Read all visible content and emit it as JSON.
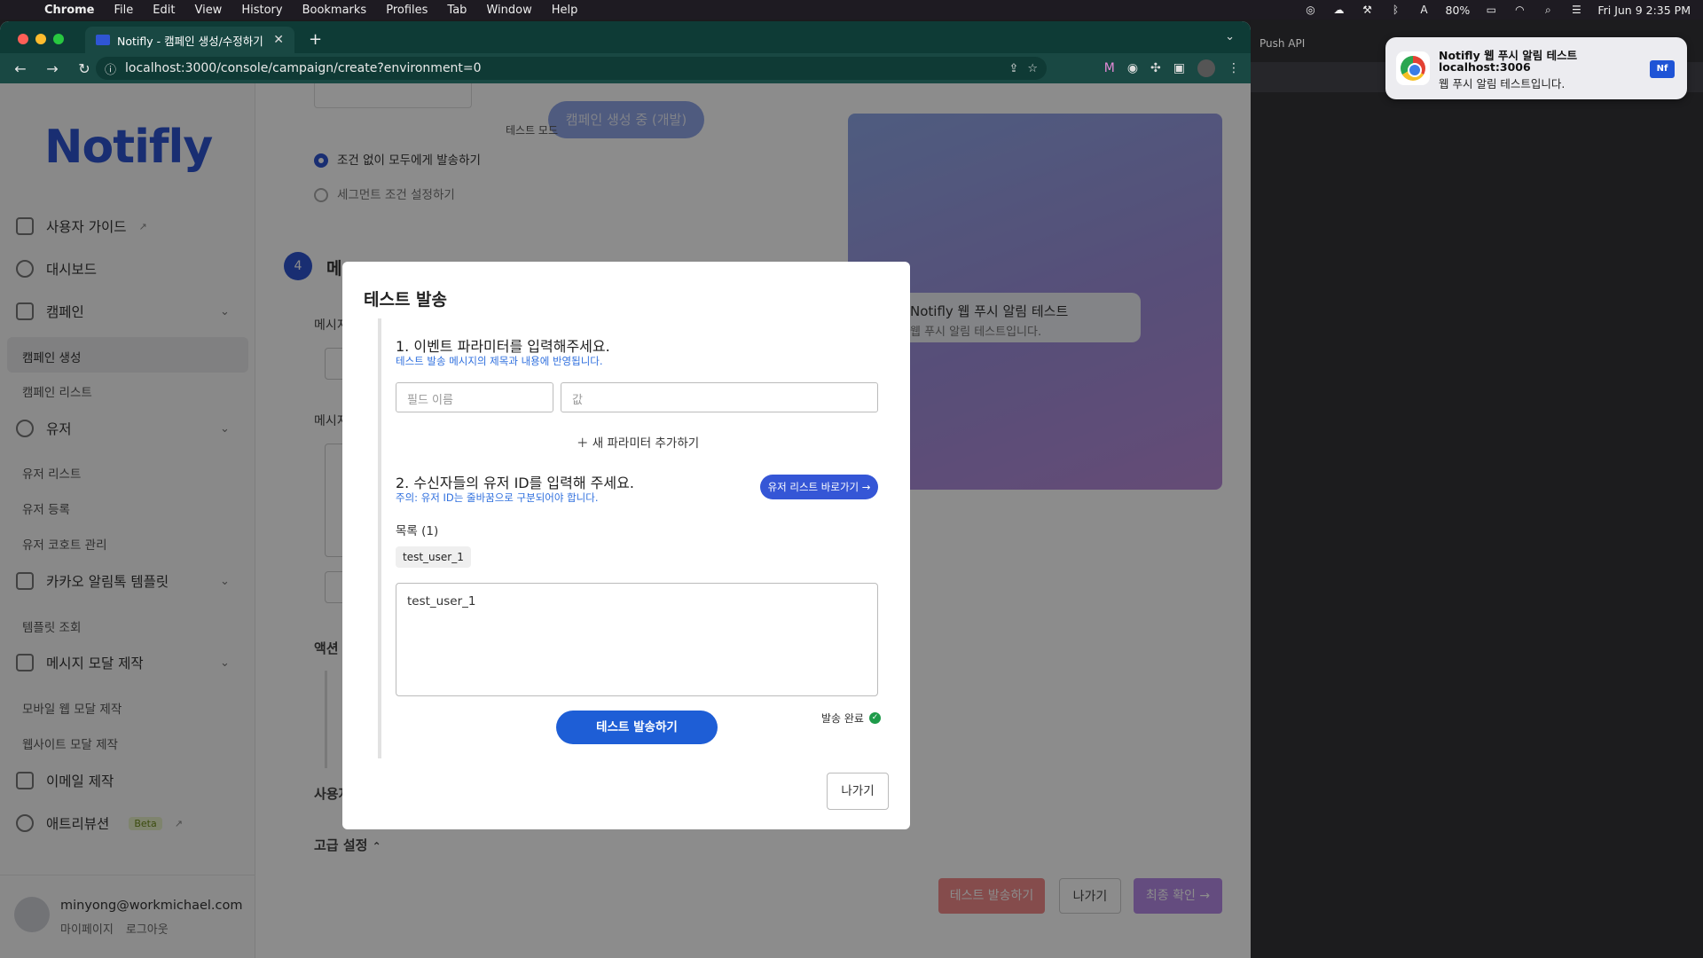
{
  "menubar": {
    "app": "Chrome",
    "menus": [
      "File",
      "Edit",
      "View",
      "History",
      "Bookmarks",
      "Profiles",
      "Tab",
      "Window",
      "Help"
    ],
    "battery": "80%",
    "datetime": "Fri Jun 9  2:35 PM"
  },
  "browser": {
    "tab_title": "Notifly - 캠페인 생성/수정하기",
    "url": "localhost:3000/console/campaign/create?environment=0",
    "bg_tab": "Push API"
  },
  "sidebar": {
    "logo": "Notifly",
    "items": [
      {
        "label": "사용자 가이드"
      },
      {
        "label": "대시보드"
      },
      {
        "label": "캠페인"
      },
      {
        "label": "유저"
      },
      {
        "label": "카카오 알림톡 템플릿"
      },
      {
        "label": "메시지 모달 제작"
      },
      {
        "label": "이메일 제작"
      },
      {
        "label": "애트리뷰션"
      }
    ],
    "beta": "Beta",
    "sub": {
      "campaign_create": "캠페인 생성",
      "campaign_list": "캠페인 리스트",
      "user_list": "유저 리스트",
      "user_register": "유저 등록",
      "user_cohort": "유저 코호트 관리",
      "template_view": "템플릿 조회",
      "mobile_modal": "모바일 웹 모달 제작",
      "website_modal": "웹사이트 모달 제작"
    },
    "user_email": "minyong@workmichael.com",
    "mypage": "마이페이지",
    "logout": "로그아웃"
  },
  "content": {
    "status_pill": "캠페인 생성 중 (개발)",
    "test_mode": "테스트 모드",
    "radio_all": "조건 없이 모두에게 발송하기",
    "radio_segment": "세그먼트 조건 설정하기",
    "step_num": "4",
    "step_title": "메",
    "label_msg1": "메시지",
    "label_msg2": "메시지",
    "label_action": "액션",
    "label_user": "사용자",
    "advanced": "고급 설정",
    "preview_title": "Notifly 웹 푸시 알림 테스트",
    "preview_body": "웹 푸시 알림 테스트입니다.",
    "btn_test": "테스트 발송하기",
    "btn_exit": "나가기",
    "btn_confirm": "최종 확인 →"
  },
  "modal": {
    "title": "테스트 발송",
    "step1_title": "1. 이벤트 파라미터를 입력해주세요.",
    "step1_sub": "테스트 발송 메시지의 제목과 내용에 반영됩니다.",
    "field_placeholder": "필드 이름",
    "value_placeholder": "값",
    "add_param": "새 파라미터 추가하기",
    "step2_title": "2. 수신자들의 유저 ID를 입력해 주세요.",
    "step2_sub": "주의: 유저 ID는 줄바꿈으로 구분되어야 합니다.",
    "user_list_btn": "유저 리스트 바로가기 →",
    "list_label": "목록 (1)",
    "chip": "test_user_1",
    "textarea_value": "test_user_1",
    "send_btn": "테스트 발송하기",
    "status": "발송 완료",
    "exit_btn": "나가기"
  },
  "notification": {
    "title": "Notifly 웹 푸시 알림 테스트",
    "source": "localhost:3006",
    "body": "웹 푸시 알림 테스트입니다.",
    "badge": "Nf"
  }
}
